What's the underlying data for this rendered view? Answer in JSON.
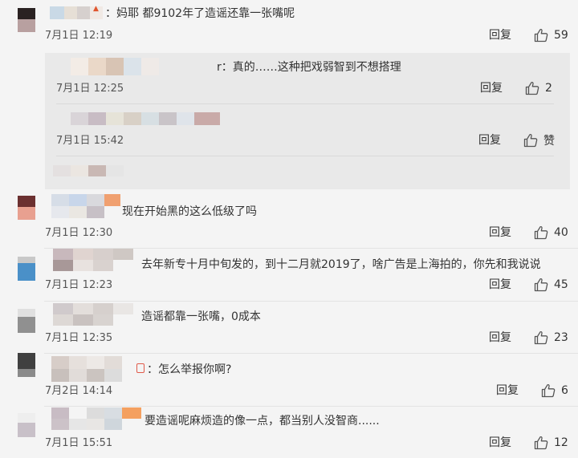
{
  "comments": [
    {
      "text": "：妈耶 都9102年了造谣还靠一张嘴呢",
      "time": "7月1日 12:19",
      "reply": "回复",
      "likes": "59"
    },
    {
      "text": "现在开始黑的这么低级了吗",
      "time": "7月1日 12:30",
      "reply": "回复",
      "likes": "40"
    },
    {
      "text": "去年新专十月中旬发的，到十二月就2019了，啥广告是上海拍的，你先和我说说",
      "time": "7月1日 12:23",
      "reply": "回复",
      "likes": "45"
    },
    {
      "text": "造谣都靠一张嘴，0成本",
      "time": "7月1日 12:35",
      "reply": "回复",
      "likes": "23"
    },
    {
      "text": "：怎么举报你啊?",
      "time": "7月2日 14:14",
      "reply": "回复",
      "likes": "6"
    },
    {
      "text": "要造谣呢麻烦造的像一点，都当别人没智商......",
      "time": "7月1日 15:51",
      "reply": "回复",
      "likes": "12"
    }
  ],
  "replies": [
    {
      "text": "r：真的……这种把戏弱智到不想搭理",
      "time": "7月1日 12:25",
      "reply": "回复",
      "likes": "2"
    },
    {
      "text": "",
      "time": "7月1日 15:42",
      "reply": "回复",
      "likes": "赞"
    }
  ],
  "icons": {
    "like": "thumbs-up-icon"
  },
  "colors": {
    "background": "#f4f4f4",
    "subpanel": "#e9e9e9",
    "text": "#333333",
    "time": "#555555"
  }
}
